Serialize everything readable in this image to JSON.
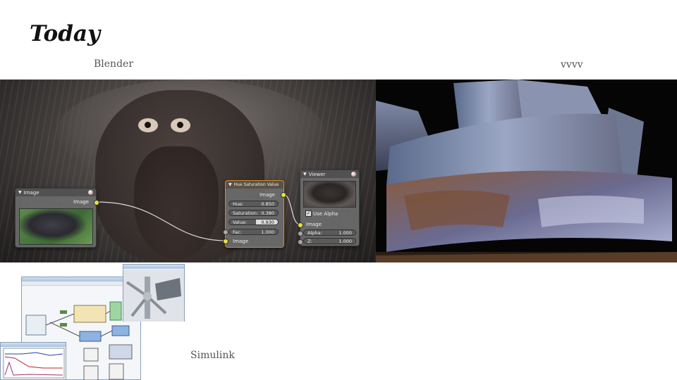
{
  "slide": {
    "title": "Today"
  },
  "captions": {
    "blender": "Blender",
    "vvvv": "vvvv",
    "simulink": "Simulink"
  },
  "blender_nodes": {
    "image_node": {
      "title": "Image",
      "output_label": "Image"
    },
    "hsv_node": {
      "title": "Hue Saturation Value",
      "output_label": "Image",
      "fields": [
        {
          "label": "Hue:",
          "value": "0.850"
        },
        {
          "label": "Saturation:",
          "value": "0.380"
        },
        {
          "label": "Value:",
          "value": "0.930"
        },
        {
          "label": "Fac:",
          "value": "1.000"
        }
      ],
      "input_label": "Image"
    },
    "viewer_node": {
      "title": "Viewer",
      "use_alpha_label": "Use Alpha",
      "use_alpha_checked": true,
      "image_label": "Image",
      "fields": [
        {
          "label": "Alpha:",
          "value": "1.000"
        },
        {
          "label": "Z:",
          "value": "1.000"
        }
      ]
    }
  },
  "colors": {
    "socket_yellow": "#e8e03a",
    "socket_gray": "#a8a8a8",
    "title_text": "#111111",
    "caption_text": "#555555"
  }
}
